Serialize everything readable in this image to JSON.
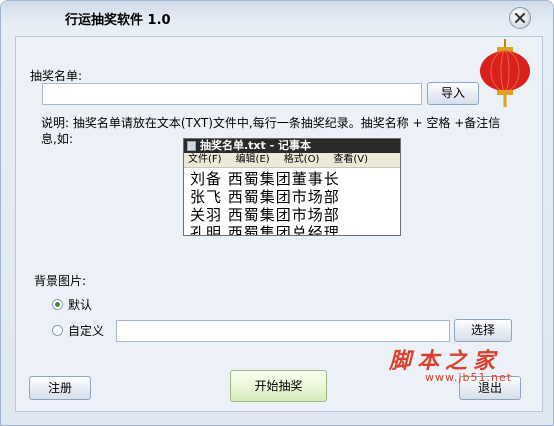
{
  "window": {
    "title": "行运抽奖软件 1.0"
  },
  "form": {
    "list_label": "抽奖名单:",
    "list_value": "",
    "import_button": "导入",
    "instructions": "说明: 抽奖名单请放在文本(TXT)文件中,每行一条抽奖纪录。抽奖名称 + 空格 +备注信息,如:",
    "background_label": "背景图片:",
    "option_default": "默认",
    "option_custom": "自定义",
    "custom_path_value": "",
    "select_button": "选择"
  },
  "notepad": {
    "title": "抽奖名单.txt - 记事本",
    "menu": [
      "文件(F)",
      "编辑(E)",
      "格式(O)",
      "查看(V)"
    ],
    "lines": [
      "刘备 西蜀集团董事长",
      "张飞 西蜀集团市场部",
      "关羽 西蜀集团市场部",
      "孔明 西蜀集团总经理"
    ]
  },
  "footer": {
    "register_button": "注册",
    "start_button": "开始抽奖",
    "exit_button": "退出"
  },
  "watermark": {
    "text": "脚本之家",
    "url": "www.jb51.net"
  },
  "colors": {
    "frame": "#9fb3cc",
    "client_bg": "#ecf1f7",
    "watermark": "#d9412f",
    "lantern": "#d8201c"
  },
  "radio_selected": "default"
}
